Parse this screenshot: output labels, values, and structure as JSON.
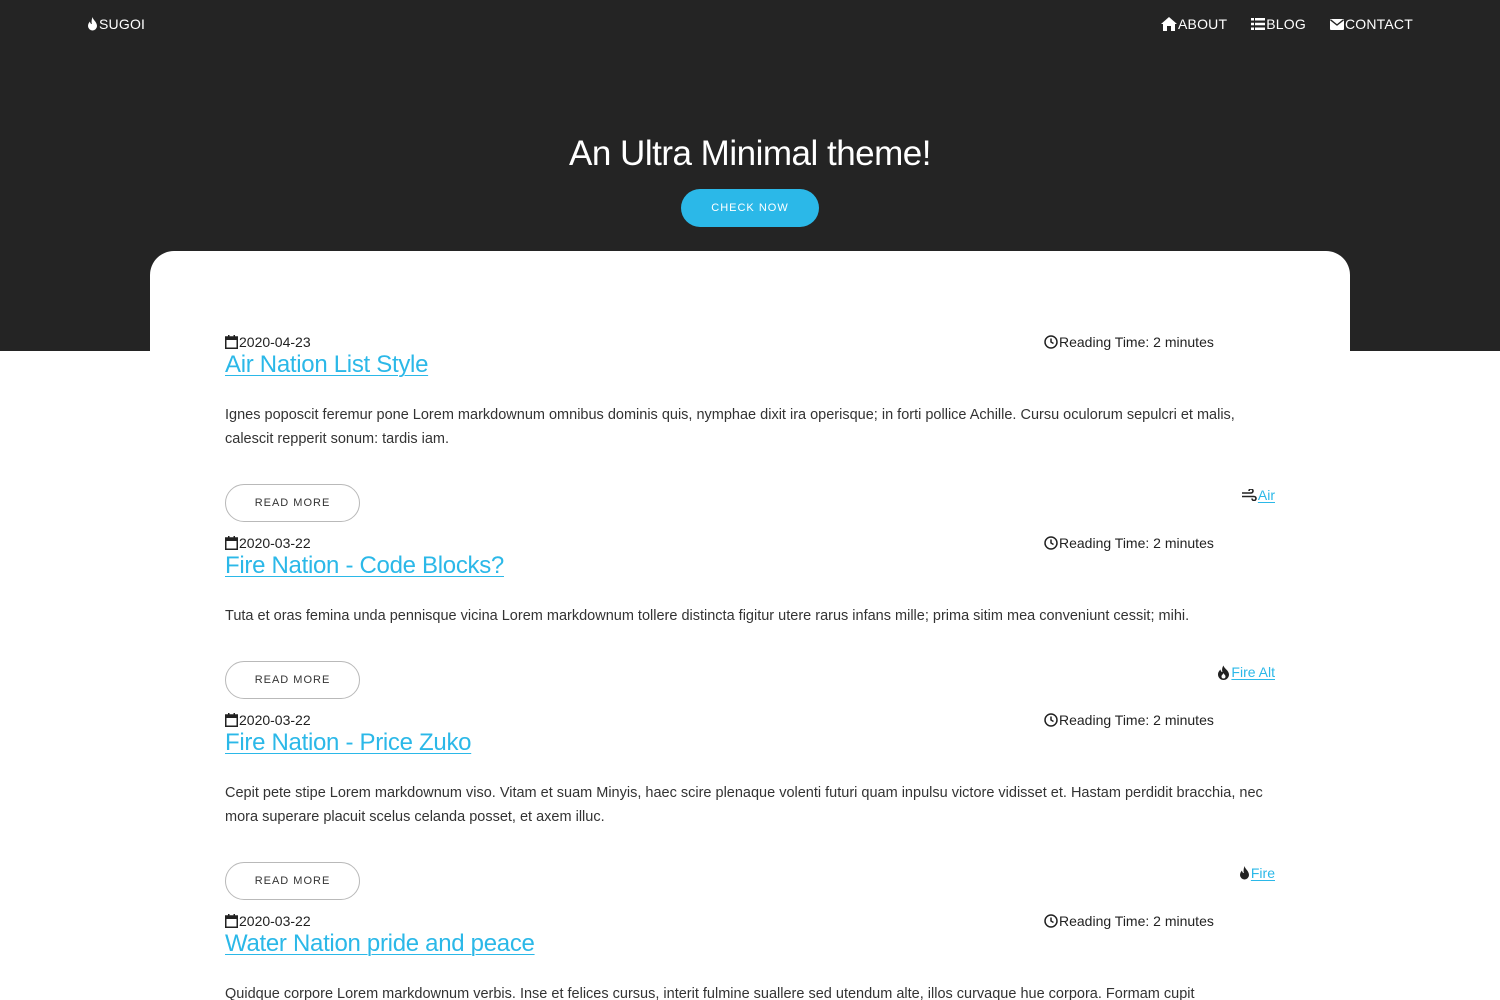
{
  "nav": {
    "brand": "SUGOI",
    "links": [
      {
        "label": "ABOUT",
        "icon": "home-icon"
      },
      {
        "label": "BLOG",
        "icon": "list-icon"
      },
      {
        "label": "CONTACT",
        "icon": "envelope-icon"
      }
    ]
  },
  "hero": {
    "title": "An Ultra Minimal theme!",
    "button_label": "CHECK NOW"
  },
  "colors": {
    "hero_bg": "#242424",
    "accent": "#2bb8e8",
    "text": "#222222"
  },
  "posts": [
    {
      "date": "2020-04-23",
      "reading_time": "Reading Time: 2 minutes",
      "title": "Air Nation List Style",
      "excerpt": "Ignes poposcit feremur pone Lorem markdownum omnibus dominis quis, nymphae dixit ira operisque; in forti pollice Achille. Cursu oculorum sepulcri et malis, calescit repperit sonum: tardis iam.",
      "button_label": "READ MORE",
      "tag": "Air",
      "tag_icon": "wind-icon"
    },
    {
      "date": "2020-03-22",
      "reading_time": "Reading Time: 2 minutes",
      "title": "Fire Nation - Code Blocks?",
      "excerpt": "Tuta et oras femina unda pennisque vicina Lorem markdownum tollere distincta figitur utere rarus infans mille; prima sitim mea conveniunt cessit; mihi.",
      "button_label": "READ MORE",
      "tag": "Fire Alt",
      "tag_icon": "fire-alt-icon"
    },
    {
      "date": "2020-03-22",
      "reading_time": "Reading Time: 2 minutes",
      "title": "Fire Nation - Price Zuko",
      "excerpt": "Cepit pete stipe Lorem markdownum viso. Vitam et suam Minyis, haec scire plenaque volenti futuri quam inpulsu victore vidisset et. Hastam perdidit bracchia, nec mora superare placuit scelus celanda posset, et axem illuc.",
      "button_label": "READ MORE",
      "tag": "Fire",
      "tag_icon": "fire-icon"
    },
    {
      "date": "2020-03-22",
      "reading_time": "Reading Time: 2 minutes",
      "title": "Water Nation pride and peace",
      "excerpt": "Quidque corpore Lorem markdownum verbis. Inse et felices cursus, interit fulmine suallere sed utendum alte, illos curvaque hue corpora. Formam cupit"
    }
  ]
}
